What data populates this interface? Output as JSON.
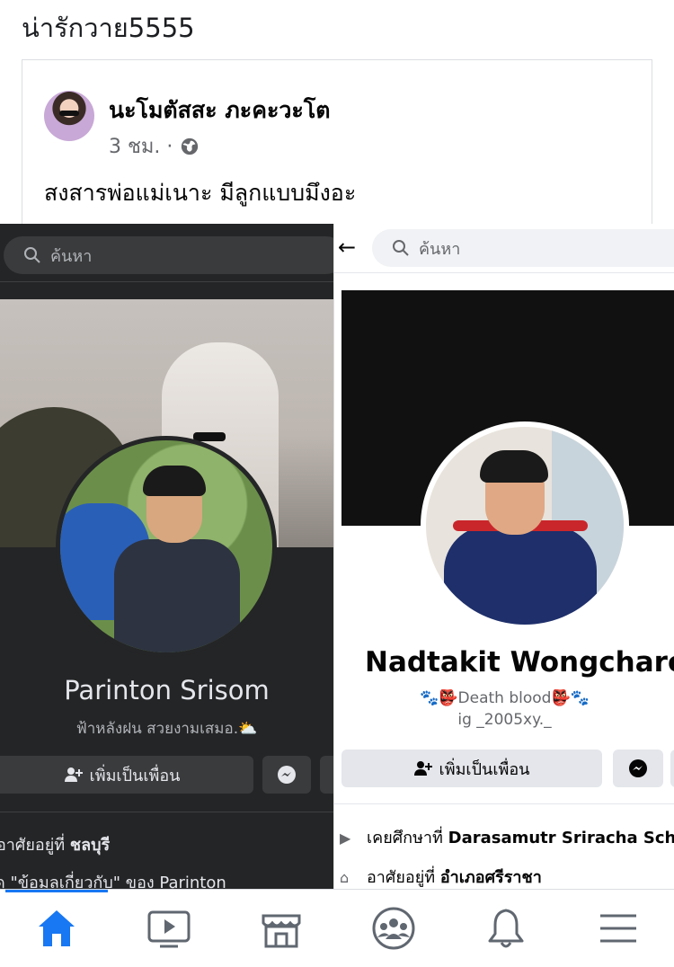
{
  "caption": "น่ารักวาย5555",
  "post": {
    "author": "นะโมตัสสะ ภะคะวะโต",
    "time": "3 ชม. ·",
    "text": "สงสารพ่อแม่เนาะ มีลูกแบบมึงอะ"
  },
  "left_profile": {
    "search_placeholder": "ค้นหา",
    "name": "Parinton Srisom",
    "bio": "ฟ้าหลังฝน สวยงามเสมอ.⛅",
    "add_friend_label": "เพิ่มเป็นเพื่อน",
    "info_lives_prefix": "อาศัยอยู่ที่",
    "info_lives_value": "ชลบุรี",
    "info_about_prefix": "ดู",
    "info_about_link": "\"ข้อมูลเกี่ยวกับ\"",
    "info_about_suffix": "ของ Parinton"
  },
  "right_profile": {
    "search_placeholder": "ค้นหา",
    "name": "Nadtakit Wongcharoen",
    "bio_line1": "🐾👺Death blood👺🐾",
    "bio_line2": "ig _2005xy._",
    "add_friend_label": "เพิ่มเป็นเพื่อน",
    "info_studied_prefix": "เคยศึกษาที่",
    "info_studied_value": "Darasamutr Sriracha School",
    "info_lives_prefix": "อาศัยอยู่ที่",
    "info_lives_value": "อำเภอศรีราชา"
  },
  "bottom_nav": [
    "home-icon",
    "watch-icon",
    "marketplace-icon",
    "groups-icon",
    "notifications-icon",
    "menu-icon"
  ],
  "colors": {
    "accent": "#1877f2",
    "dark_bg": "#242526"
  }
}
